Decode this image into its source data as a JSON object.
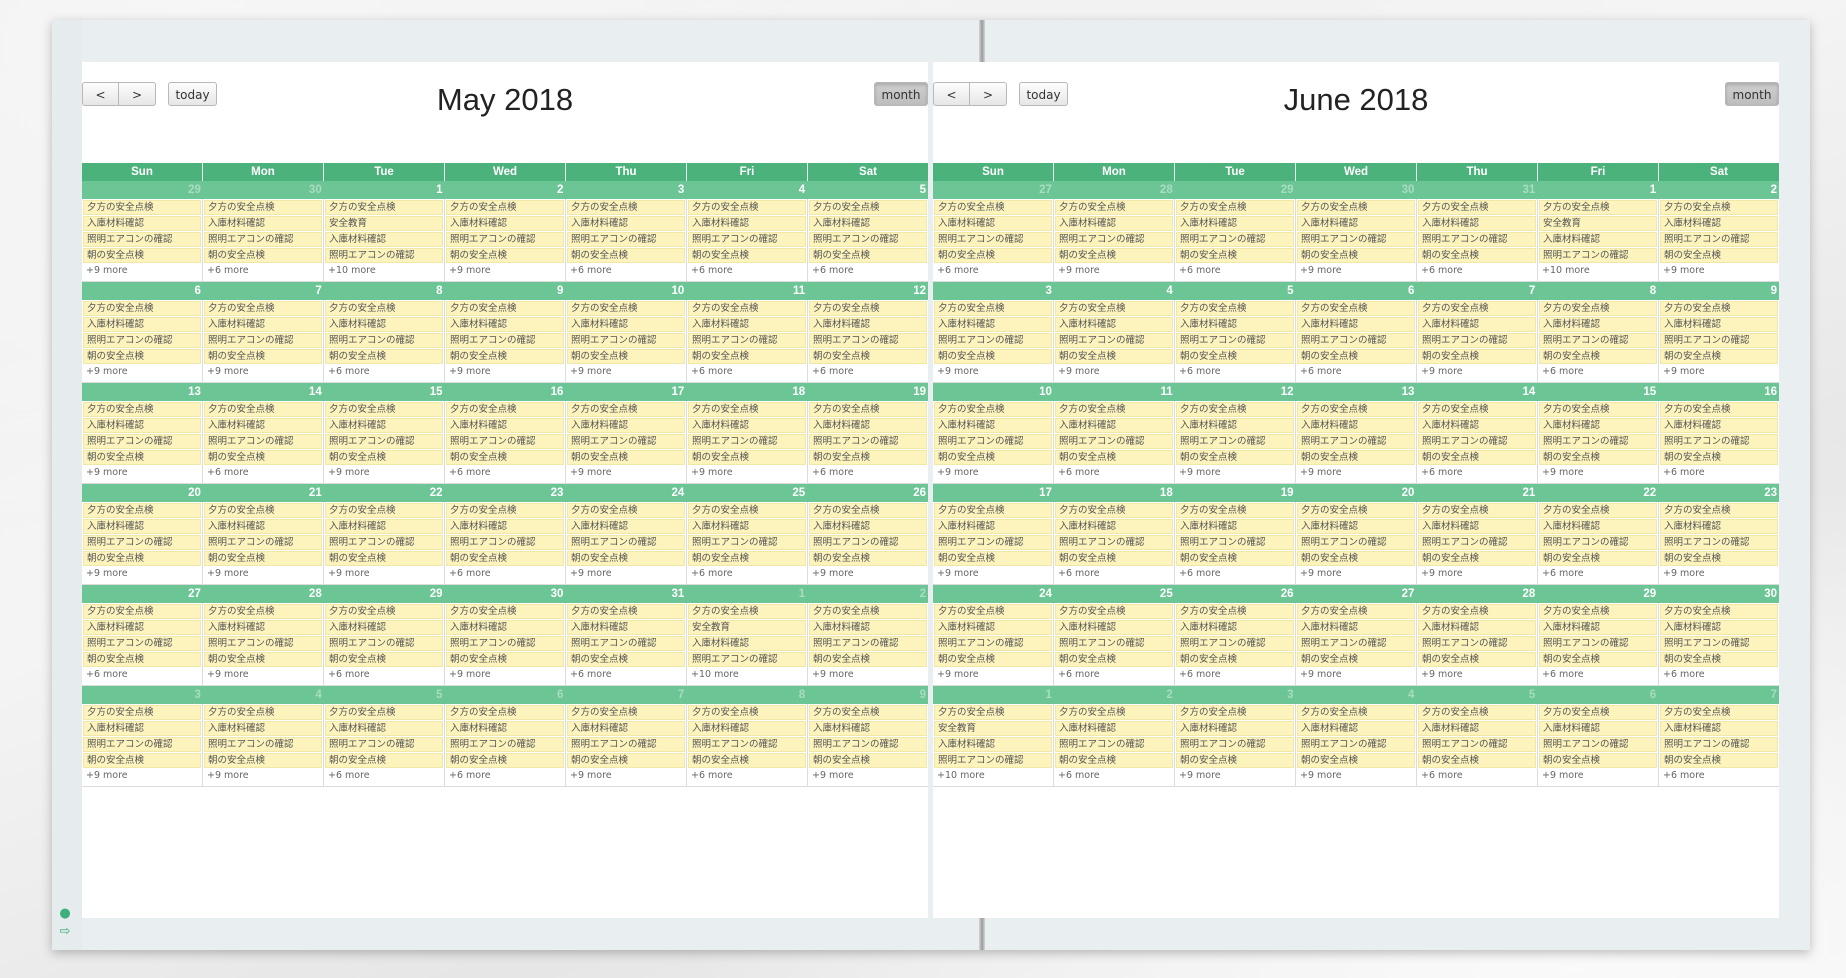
{
  "left_calendar": {
    "title": "May 2018",
    "buttons": {
      "prev": "<",
      "next": ">",
      "today": "today",
      "month": "month"
    },
    "weekdays": [
      "Sun",
      "Mon",
      "Tue",
      "Wed",
      "Thu",
      "Fri",
      "Sat"
    ],
    "weeks": [
      [
        {
          "n": "29",
          "o": true,
          "e": [
            "夕方の安全点検",
            "入庫材料確認",
            "照明エアコンの確認",
            "朝の安全点検"
          ],
          "m": "+9 more"
        },
        {
          "n": "30",
          "o": true,
          "e": [
            "夕方の安全点検",
            "入庫材料確認",
            "照明エアコンの確認",
            "朝の安全点検"
          ],
          "m": "+6 more"
        },
        {
          "n": "1",
          "o": false,
          "e": [
            "夕方の安全点検",
            "安全教育",
            "入庫材料確認",
            "照明エアコンの確認"
          ],
          "m": "+10 more"
        },
        {
          "n": "2",
          "o": false,
          "e": [
            "夕方の安全点検",
            "入庫材料確認",
            "照明エアコンの確認",
            "朝の安全点検"
          ],
          "m": "+9 more"
        },
        {
          "n": "3",
          "o": false,
          "e": [
            "夕方の安全点検",
            "入庫材料確認",
            "照明エアコンの確認",
            "朝の安全点検"
          ],
          "m": "+6 more"
        },
        {
          "n": "4",
          "o": false,
          "e": [
            "夕方の安全点検",
            "入庫材料確認",
            "照明エアコンの確認",
            "朝の安全点検"
          ],
          "m": "+6 more"
        },
        {
          "n": "5",
          "o": false,
          "e": [
            "夕方の安全点検",
            "入庫材料確認",
            "照明エアコンの確認",
            "朝の安全点検"
          ],
          "m": "+6 more"
        }
      ],
      [
        {
          "n": "6",
          "o": false,
          "e": [
            "夕方の安全点検",
            "入庫材料確認",
            "照明エアコンの確認",
            "朝の安全点検"
          ],
          "m": "+9 more"
        },
        {
          "n": "7",
          "o": false,
          "e": [
            "夕方の安全点検",
            "入庫材料確認",
            "照明エアコンの確認",
            "朝の安全点検"
          ],
          "m": "+9 more"
        },
        {
          "n": "8",
          "o": false,
          "e": [
            "夕方の安全点検",
            "入庫材料確認",
            "照明エアコンの確認",
            "朝の安全点検"
          ],
          "m": "+6 more"
        },
        {
          "n": "9",
          "o": false,
          "e": [
            "夕方の安全点検",
            "入庫材料確認",
            "照明エアコンの確認",
            "朝の安全点検"
          ],
          "m": "+9 more"
        },
        {
          "n": "10",
          "o": false,
          "e": [
            "夕方の安全点検",
            "入庫材料確認",
            "照明エアコンの確認",
            "朝の安全点検"
          ],
          "m": "+9 more"
        },
        {
          "n": "11",
          "o": false,
          "e": [
            "夕方の安全点検",
            "入庫材料確認",
            "照明エアコンの確認",
            "朝の安全点検"
          ],
          "m": "+6 more"
        },
        {
          "n": "12",
          "o": false,
          "e": [
            "夕方の安全点検",
            "入庫材料確認",
            "照明エアコンの確認",
            "朝の安全点検"
          ],
          "m": "+6 more"
        }
      ],
      [
        {
          "n": "13",
          "o": false,
          "e": [
            "夕方の安全点検",
            "入庫材料確認",
            "照明エアコンの確認",
            "朝の安全点検"
          ],
          "m": "+9 more"
        },
        {
          "n": "14",
          "o": false,
          "e": [
            "夕方の安全点検",
            "入庫材料確認",
            "照明エアコンの確認",
            "朝の安全点検"
          ],
          "m": "+6 more"
        },
        {
          "n": "15",
          "o": false,
          "e": [
            "夕方の安全点検",
            "入庫材料確認",
            "照明エアコンの確認",
            "朝の安全点検"
          ],
          "m": "+9 more"
        },
        {
          "n": "16",
          "o": false,
          "e": [
            "夕方の安全点検",
            "入庫材料確認",
            "照明エアコンの確認",
            "朝の安全点検"
          ],
          "m": "+6 more"
        },
        {
          "n": "17",
          "o": false,
          "e": [
            "夕方の安全点検",
            "入庫材料確認",
            "照明エアコンの確認",
            "朝の安全点検"
          ],
          "m": "+9 more"
        },
        {
          "n": "18",
          "o": false,
          "e": [
            "夕方の安全点検",
            "入庫材料確認",
            "照明エアコンの確認",
            "朝の安全点検"
          ],
          "m": "+9 more"
        },
        {
          "n": "19",
          "o": false,
          "e": [
            "夕方の安全点検",
            "入庫材料確認",
            "照明エアコンの確認",
            "朝の安全点検"
          ],
          "m": "+6 more"
        }
      ],
      [
        {
          "n": "20",
          "o": false,
          "e": [
            "夕方の安全点検",
            "入庫材料確認",
            "照明エアコンの確認",
            "朝の安全点検"
          ],
          "m": "+9 more"
        },
        {
          "n": "21",
          "o": false,
          "e": [
            "夕方の安全点検",
            "入庫材料確認",
            "照明エアコンの確認",
            "朝の安全点検"
          ],
          "m": "+9 more"
        },
        {
          "n": "22",
          "o": false,
          "e": [
            "夕方の安全点検",
            "入庫材料確認",
            "照明エアコンの確認",
            "朝の安全点検"
          ],
          "m": "+9 more"
        },
        {
          "n": "23",
          "o": false,
          "e": [
            "夕方の安全点検",
            "入庫材料確認",
            "照明エアコンの確認",
            "朝の安全点検"
          ],
          "m": "+6 more"
        },
        {
          "n": "24",
          "o": false,
          "e": [
            "夕方の安全点検",
            "入庫材料確認",
            "照明エアコンの確認",
            "朝の安全点検"
          ],
          "m": "+9 more"
        },
        {
          "n": "25",
          "o": false,
          "e": [
            "夕方の安全点検",
            "入庫材料確認",
            "照明エアコンの確認",
            "朝の安全点検"
          ],
          "m": "+6 more"
        },
        {
          "n": "26",
          "o": false,
          "e": [
            "夕方の安全点検",
            "入庫材料確認",
            "照明エアコンの確認",
            "朝の安全点検"
          ],
          "m": "+9 more"
        }
      ],
      [
        {
          "n": "27",
          "o": false,
          "e": [
            "夕方の安全点検",
            "入庫材料確認",
            "照明エアコンの確認",
            "朝の安全点検"
          ],
          "m": "+6 more"
        },
        {
          "n": "28",
          "o": false,
          "e": [
            "夕方の安全点検",
            "入庫材料確認",
            "照明エアコンの確認",
            "朝の安全点検"
          ],
          "m": "+9 more"
        },
        {
          "n": "29",
          "o": false,
          "e": [
            "夕方の安全点検",
            "入庫材料確認",
            "照明エアコンの確認",
            "朝の安全点検"
          ],
          "m": "+6 more"
        },
        {
          "n": "30",
          "o": false,
          "e": [
            "夕方の安全点検",
            "入庫材料確認",
            "照明エアコンの確認",
            "朝の安全点検"
          ],
          "m": "+9 more"
        },
        {
          "n": "31",
          "o": false,
          "e": [
            "夕方の安全点検",
            "入庫材料確認",
            "照明エアコンの確認",
            "朝の安全点検"
          ],
          "m": "+6 more"
        },
        {
          "n": "1",
          "o": true,
          "e": [
            "夕方の安全点検",
            "安全教育",
            "入庫材料確認",
            "照明エアコンの確認"
          ],
          "m": "+10 more"
        },
        {
          "n": "2",
          "o": true,
          "e": [
            "夕方の安全点検",
            "入庫材料確認",
            "照明エアコンの確認",
            "朝の安全点検"
          ],
          "m": "+9 more"
        }
      ],
      [
        {
          "n": "3",
          "o": true,
          "e": [
            "夕方の安全点検",
            "入庫材料確認",
            "照明エアコンの確認",
            "朝の安全点検"
          ],
          "m": "+9 more"
        },
        {
          "n": "4",
          "o": true,
          "e": [
            "夕方の安全点検",
            "入庫材料確認",
            "照明エアコンの確認",
            "朝の安全点検"
          ],
          "m": "+9 more"
        },
        {
          "n": "5",
          "o": true,
          "e": [
            "夕方の安全点検",
            "入庫材料確認",
            "照明エアコンの確認",
            "朝の安全点検"
          ],
          "m": "+6 more"
        },
        {
          "n": "6",
          "o": true,
          "e": [
            "夕方の安全点検",
            "入庫材料確認",
            "照明エアコンの確認",
            "朝の安全点検"
          ],
          "m": "+6 more"
        },
        {
          "n": "7",
          "o": true,
          "e": [
            "夕方の安全点検",
            "入庫材料確認",
            "照明エアコンの確認",
            "朝の安全点検"
          ],
          "m": "+9 more"
        },
        {
          "n": "8",
          "o": true,
          "e": [
            "夕方の安全点検",
            "入庫材料確認",
            "照明エアコンの確認",
            "朝の安全点検"
          ],
          "m": "+6 more"
        },
        {
          "n": "9",
          "o": true,
          "e": [
            "夕方の安全点検",
            "入庫材料確認",
            "照明エアコンの確認",
            "朝の安全点検"
          ],
          "m": "+9 more"
        }
      ]
    ]
  },
  "right_calendar": {
    "title": "June 2018",
    "buttons": {
      "prev": "<",
      "next": ">",
      "today": "today",
      "month": "month"
    },
    "weekdays": [
      "Sun",
      "Mon",
      "Tue",
      "Wed",
      "Thu",
      "Fri",
      "Sat"
    ],
    "weeks": [
      [
        {
          "n": "27",
          "o": true,
          "e": [
            "夕方の安全点検",
            "入庫材料確認",
            "照明エアコンの確認",
            "朝の安全点検"
          ],
          "m": "+6 more"
        },
        {
          "n": "28",
          "o": true,
          "e": [
            "夕方の安全点検",
            "入庫材料確認",
            "照明エアコンの確認",
            "朝の安全点検"
          ],
          "m": "+9 more"
        },
        {
          "n": "29",
          "o": true,
          "e": [
            "夕方の安全点検",
            "入庫材料確認",
            "照明エアコンの確認",
            "朝の安全点検"
          ],
          "m": "+6 more"
        },
        {
          "n": "30",
          "o": true,
          "e": [
            "夕方の安全点検",
            "入庫材料確認",
            "照明エアコンの確認",
            "朝の安全点検"
          ],
          "m": "+9 more"
        },
        {
          "n": "31",
          "o": true,
          "e": [
            "夕方の安全点検",
            "入庫材料確認",
            "照明エアコンの確認",
            "朝の安全点検"
          ],
          "m": "+6 more"
        },
        {
          "n": "1",
          "o": false,
          "e": [
            "夕方の安全点検",
            "安全教育",
            "入庫材料確認",
            "照明エアコンの確認"
          ],
          "m": "+10 more"
        },
        {
          "n": "2",
          "o": false,
          "e": [
            "夕方の安全点検",
            "入庫材料確認",
            "照明エアコンの確認",
            "朝の安全点検"
          ],
          "m": "+9 more"
        }
      ],
      [
        {
          "n": "3",
          "o": false,
          "e": [
            "夕方の安全点検",
            "入庫材料確認",
            "照明エアコンの確認",
            "朝の安全点検"
          ],
          "m": "+9 more"
        },
        {
          "n": "4",
          "o": false,
          "e": [
            "夕方の安全点検",
            "入庫材料確認",
            "照明エアコンの確認",
            "朝の安全点検"
          ],
          "m": "+9 more"
        },
        {
          "n": "5",
          "o": false,
          "e": [
            "夕方の安全点検",
            "入庫材料確認",
            "照明エアコンの確認",
            "朝の安全点検"
          ],
          "m": "+6 more"
        },
        {
          "n": "6",
          "o": false,
          "e": [
            "夕方の安全点検",
            "入庫材料確認",
            "照明エアコンの確認",
            "朝の安全点検"
          ],
          "m": "+6 more"
        },
        {
          "n": "7",
          "o": false,
          "e": [
            "夕方の安全点検",
            "入庫材料確認",
            "照明エアコンの確認",
            "朝の安全点検"
          ],
          "m": "+9 more"
        },
        {
          "n": "8",
          "o": false,
          "e": [
            "夕方の安全点検",
            "入庫材料確認",
            "照明エアコンの確認",
            "朝の安全点検"
          ],
          "m": "+6 more"
        },
        {
          "n": "9",
          "o": false,
          "e": [
            "夕方の安全点検",
            "入庫材料確認",
            "照明エアコンの確認",
            "朝の安全点検"
          ],
          "m": "+9 more"
        }
      ],
      [
        {
          "n": "10",
          "o": false,
          "e": [
            "夕方の安全点検",
            "入庫材料確認",
            "照明エアコンの確認",
            "朝の安全点検"
          ],
          "m": "+9 more"
        },
        {
          "n": "11",
          "o": false,
          "e": [
            "夕方の安全点検",
            "入庫材料確認",
            "照明エアコンの確認",
            "朝の安全点検"
          ],
          "m": "+6 more"
        },
        {
          "n": "12",
          "o": false,
          "e": [
            "夕方の安全点検",
            "入庫材料確認",
            "照明エアコンの確認",
            "朝の安全点検"
          ],
          "m": "+9 more"
        },
        {
          "n": "13",
          "o": false,
          "e": [
            "夕方の安全点検",
            "入庫材料確認",
            "照明エアコンの確認",
            "朝の安全点検"
          ],
          "m": "+9 more"
        },
        {
          "n": "14",
          "o": false,
          "e": [
            "夕方の安全点検",
            "入庫材料確認",
            "照明エアコンの確認",
            "朝の安全点検"
          ],
          "m": "+6 more"
        },
        {
          "n": "15",
          "o": false,
          "e": [
            "夕方の安全点検",
            "入庫材料確認",
            "照明エアコンの確認",
            "朝の安全点検"
          ],
          "m": "+9 more"
        },
        {
          "n": "16",
          "o": false,
          "e": [
            "夕方の安全点検",
            "入庫材料確認",
            "照明エアコンの確認",
            "朝の安全点検"
          ],
          "m": "+6 more"
        }
      ],
      [
        {
          "n": "17",
          "o": false,
          "e": [
            "夕方の安全点検",
            "入庫材料確認",
            "照明エアコンの確認",
            "朝の安全点検"
          ],
          "m": "+9 more"
        },
        {
          "n": "18",
          "o": false,
          "e": [
            "夕方の安全点検",
            "入庫材料確認",
            "照明エアコンの確認",
            "朝の安全点検"
          ],
          "m": "+6 more"
        },
        {
          "n": "19",
          "o": false,
          "e": [
            "夕方の安全点検",
            "入庫材料確認",
            "照明エアコンの確認",
            "朝の安全点検"
          ],
          "m": "+6 more"
        },
        {
          "n": "20",
          "o": false,
          "e": [
            "夕方の安全点検",
            "入庫材料確認",
            "照明エアコンの確認",
            "朝の安全点検"
          ],
          "m": "+9 more"
        },
        {
          "n": "21",
          "o": false,
          "e": [
            "夕方の安全点検",
            "入庫材料確認",
            "照明エアコンの確認",
            "朝の安全点検"
          ],
          "m": "+9 more"
        },
        {
          "n": "22",
          "o": false,
          "e": [
            "夕方の安全点検",
            "入庫材料確認",
            "照明エアコンの確認",
            "朝の安全点検"
          ],
          "m": "+6 more"
        },
        {
          "n": "23",
          "o": false,
          "e": [
            "夕方の安全点検",
            "入庫材料確認",
            "照明エアコンの確認",
            "朝の安全点検"
          ],
          "m": "+9 more"
        }
      ],
      [
        {
          "n": "24",
          "o": false,
          "e": [
            "夕方の安全点検",
            "入庫材料確認",
            "照明エアコンの確認",
            "朝の安全点検"
          ],
          "m": "+9 more"
        },
        {
          "n": "25",
          "o": false,
          "e": [
            "夕方の安全点検",
            "入庫材料確認",
            "照明エアコンの確認",
            "朝の安全点検"
          ],
          "m": "+6 more"
        },
        {
          "n": "26",
          "o": false,
          "e": [
            "夕方の安全点検",
            "入庫材料確認",
            "照明エアコンの確認",
            "朝の安全点検"
          ],
          "m": "+6 more"
        },
        {
          "n": "27",
          "o": false,
          "e": [
            "夕方の安全点検",
            "入庫材料確認",
            "照明エアコンの確認",
            "朝の安全点検"
          ],
          "m": "+9 more"
        },
        {
          "n": "28",
          "o": false,
          "e": [
            "夕方の安全点検",
            "入庫材料確認",
            "照明エアコンの確認",
            "朝の安全点検"
          ],
          "m": "+9 more"
        },
        {
          "n": "29",
          "o": false,
          "e": [
            "夕方の安全点検",
            "入庫材料確認",
            "照明エアコンの確認",
            "朝の安全点検"
          ],
          "m": "+6 more"
        },
        {
          "n": "30",
          "o": false,
          "e": [
            "夕方の安全点検",
            "入庫材料確認",
            "照明エアコンの確認",
            "朝の安全点検"
          ],
          "m": "+6 more"
        }
      ],
      [
        {
          "n": "1",
          "o": true,
          "e": [
            "夕方の安全点検",
            "安全教育",
            "入庫材料確認",
            "照明エアコンの確認"
          ],
          "m": "+10 more"
        },
        {
          "n": "2",
          "o": true,
          "e": [
            "夕方の安全点検",
            "入庫材料確認",
            "照明エアコンの確認",
            "朝の安全点検"
          ],
          "m": "+6 more"
        },
        {
          "n": "3",
          "o": true,
          "e": [
            "夕方の安全点検",
            "入庫材料確認",
            "照明エアコンの確認",
            "朝の安全点検"
          ],
          "m": "+9 more"
        },
        {
          "n": "4",
          "o": true,
          "e": [
            "夕方の安全点検",
            "入庫材料確認",
            "照明エアコンの確認",
            "朝の安全点検"
          ],
          "m": "+9 more"
        },
        {
          "n": "5",
          "o": true,
          "e": [
            "夕方の安全点検",
            "入庫材料確認",
            "照明エアコンの確認",
            "朝の安全点検"
          ],
          "m": "+6 more"
        },
        {
          "n": "6",
          "o": true,
          "e": [
            "夕方の安全点検",
            "入庫材料確認",
            "照明エアコンの確認",
            "朝の安全点検"
          ],
          "m": "+9 more"
        },
        {
          "n": "7",
          "o": true,
          "e": [
            "夕方の安全点検",
            "入庫材料確認",
            "照明エアコンの確認",
            "朝の安全点検"
          ],
          "m": "+6 more"
        }
      ]
    ]
  },
  "side_icons": [
    "user-icon",
    "logout-icon"
  ],
  "colors": {
    "header_green": "#4cb27b",
    "daynum_green": "#6cc595",
    "event_yellow": "#fcf3bd"
  }
}
